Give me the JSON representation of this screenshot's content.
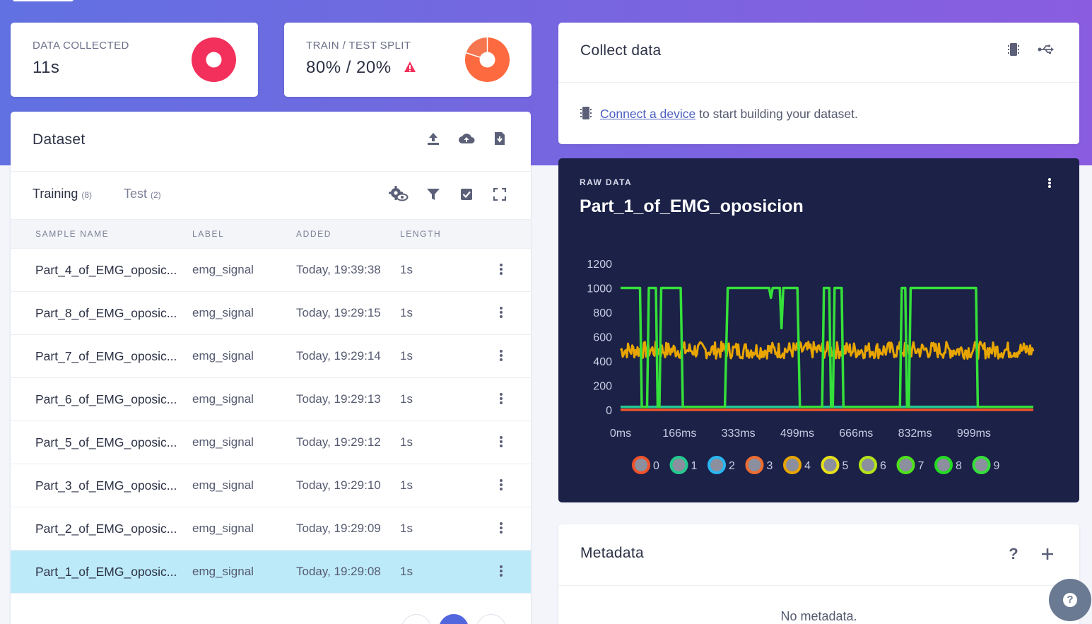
{
  "stats": {
    "data_collected": {
      "label": "DATA COLLECTED",
      "value": "11s",
      "pie_fraction": 1.0,
      "color": "#f2305b"
    },
    "split": {
      "label": "TRAIN / TEST SPLIT",
      "value": "80% / 20%",
      "pie_fraction": 0.8,
      "color": "#fd6a3f",
      "warning_icon": "warning-triangle-icon"
    }
  },
  "dataset": {
    "title": "Dataset",
    "actions": [
      "upload-icon",
      "cloud-upload-icon",
      "download-icon"
    ],
    "tabs": [
      {
        "label": "Training",
        "count": "(8)",
        "active": true
      },
      {
        "label": "Test",
        "count": "(2)",
        "active": false
      }
    ],
    "tab_actions": [
      "settings-eye-icon",
      "filter-icon",
      "select-check-icon",
      "fullscreen-icon"
    ],
    "columns": [
      "SAMPLE NAME",
      "LABEL",
      "ADDED",
      "LENGTH"
    ],
    "rows": [
      {
        "name": "Part_4_of_EMG_oposic...",
        "label": "emg_signal",
        "added": "Today, 19:39:38",
        "length": "1s"
      },
      {
        "name": "Part_8_of_EMG_oposic...",
        "label": "emg_signal",
        "added": "Today, 19:29:15",
        "length": "1s"
      },
      {
        "name": "Part_7_of_EMG_oposic...",
        "label": "emg_signal",
        "added": "Today, 19:29:14",
        "length": "1s"
      },
      {
        "name": "Part_6_of_EMG_oposic...",
        "label": "emg_signal",
        "added": "Today, 19:29:13",
        "length": "1s"
      },
      {
        "name": "Part_5_of_EMG_oposic...",
        "label": "emg_signal",
        "added": "Today, 19:29:12",
        "length": "1s"
      },
      {
        "name": "Part_3_of_EMG_oposic...",
        "label": "emg_signal",
        "added": "Today, 19:29:10",
        "length": "1s"
      },
      {
        "name": "Part_2_of_EMG_oposic...",
        "label": "emg_signal",
        "added": "Today, 19:29:09",
        "length": "1s"
      },
      {
        "name": "Part_1_of_EMG_oposic...",
        "label": "emg_signal",
        "added": "Today, 19:29:08",
        "length": "1s",
        "selected": true
      }
    ]
  },
  "collect": {
    "title": "Collect data",
    "actions": [
      "device-icon",
      "usb-icon"
    ],
    "link_text": "Connect a device",
    "message": "to start building your dataset."
  },
  "raw_data": {
    "kicker": "RAW DATA",
    "title": "Part_1_of_EMG_oposicion"
  },
  "chart_data": {
    "type": "line",
    "x_ticks": [
      "0ms",
      "166ms",
      "333ms",
      "499ms",
      "666ms",
      "832ms",
      "999ms"
    ],
    "y_ticks": [
      "1200",
      "1000",
      "800",
      "600",
      "400",
      "200",
      "0"
    ],
    "xlim": [
      0,
      1167
    ],
    "ylim": [
      0,
      1200
    ],
    "grid": false,
    "legend_position": "bottom",
    "series": [
      {
        "name": "0",
        "color": "#f0532a",
        "values_constant": 0
      },
      {
        "name": "1",
        "color": "#25c990",
        "values_constant": 25
      },
      {
        "name": "2",
        "color": "#29b6f0"
      },
      {
        "name": "3",
        "color": "#ef6c2f"
      },
      {
        "name": "4",
        "color": "#e8a500",
        "mean": 490,
        "amplitude": 70
      },
      {
        "name": "5",
        "color": "#e6e01a"
      },
      {
        "name": "6",
        "color": "#b5e319"
      },
      {
        "name": "7",
        "color": "#4ee11a"
      },
      {
        "name": "8",
        "color": "#22dd22"
      },
      {
        "name": "9",
        "color": "#35e03a",
        "steps": [
          [
            0,
            1000
          ],
          [
            55,
            1000
          ],
          [
            60,
            25
          ],
          [
            75,
            25
          ],
          [
            80,
            1000
          ],
          [
            100,
            1000
          ],
          [
            105,
            25
          ],
          [
            110,
            25
          ],
          [
            115,
            1000
          ],
          [
            170,
            1000
          ],
          [
            176,
            25
          ],
          [
            295,
            25
          ],
          [
            303,
            1000
          ],
          [
            420,
            1000
          ],
          [
            425,
            920
          ],
          [
            430,
            1000
          ],
          [
            450,
            1000
          ],
          [
            455,
            670
          ],
          [
            460,
            1000
          ],
          [
            500,
            1000
          ],
          [
            507,
            25
          ],
          [
            570,
            25
          ],
          [
            575,
            1000
          ],
          [
            590,
            1000
          ],
          [
            595,
            25
          ],
          [
            600,
            25
          ],
          [
            605,
            1000
          ],
          [
            625,
            1000
          ],
          [
            630,
            25
          ],
          [
            790,
            25
          ],
          [
            795,
            1000
          ],
          [
            805,
            1000
          ],
          [
            810,
            25
          ],
          [
            815,
            25
          ],
          [
            820,
            1000
          ],
          [
            1005,
            1000
          ],
          [
            1010,
            25
          ],
          [
            1167,
            25
          ]
        ]
      }
    ]
  },
  "metadata": {
    "title": "Metadata",
    "actions": [
      "help-icon",
      "add-icon"
    ],
    "empty": "No metadata."
  }
}
